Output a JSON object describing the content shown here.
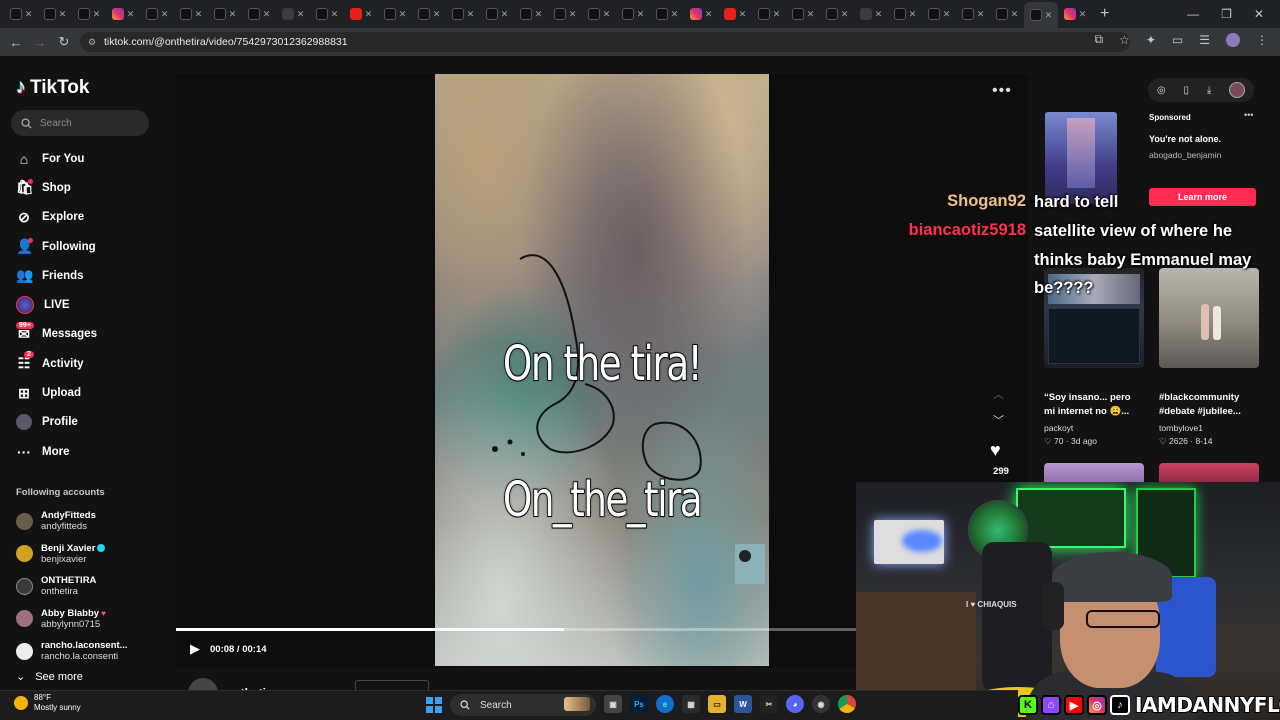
{
  "browser": {
    "url": "tiktok.com/@onthetira/video/7542973012362988831",
    "new_tab": "+",
    "win_controls": [
      "—",
      "❐",
      "✕"
    ]
  },
  "tiktok": {
    "logo_text": "TikTok",
    "search_placeholder": "Search",
    "nav": [
      {
        "label": "For You",
        "icon": "home-icon"
      },
      {
        "label": "Shop",
        "icon": "shop-icon"
      },
      {
        "label": "Explore",
        "icon": "compass-icon"
      },
      {
        "label": "Following",
        "icon": "following-icon"
      },
      {
        "label": "Friends",
        "icon": "friends-icon"
      },
      {
        "label": "LIVE",
        "icon": "live-avatar"
      },
      {
        "label": "Messages",
        "icon": "messages-icon",
        "badge": "99+"
      },
      {
        "label": "Activity",
        "icon": "activity-icon",
        "badge": "2"
      },
      {
        "label": "Upload",
        "icon": "upload-icon"
      },
      {
        "label": "Profile",
        "icon": "profile-avatar"
      },
      {
        "label": "More",
        "icon": "more-icon"
      }
    ],
    "following_header": "Following accounts",
    "accounts": [
      {
        "name": "AndyFitteds",
        "handle": "andyfitteds",
        "color": "#6b5b4b"
      },
      {
        "name": "Benji Xavier",
        "handle": "benjixavier",
        "color": "#d4a020",
        "verified": true
      },
      {
        "name": "ONTHETIRA",
        "handle": "onthetira",
        "color": "#3a3a3a"
      },
      {
        "name": "Abby Blabby",
        "handle": "abbylynn0715",
        "color": "#a07080",
        "heart": true
      },
      {
        "name": "rancho.laconsent...",
        "handle": "rancho.la.consenti",
        "color": "#eeeeee"
      }
    ],
    "see_more": "See more"
  },
  "video": {
    "overlay_line1": "On the tira!",
    "overlay_line2": "On_the_tira",
    "likes": "299",
    "time": "00:08 / 00:14",
    "progress": 0.57,
    "author": "onthetira"
  },
  "ad": {
    "sponsored": "Sponsored",
    "title": "You're not alone.",
    "handle": "abogado_benjamin",
    "cta": "Learn more"
  },
  "recommended": [
    {
      "title": "“Soy insano... pero mi internet no 😩...",
      "author": "packoyt",
      "likes": "70",
      "date": "3d ago"
    },
    {
      "title": "#blackcommunity #debate #jubilee...",
      "author": "tornbylove1",
      "likes": "2626",
      "date": "8-14"
    }
  ],
  "chat": [
    {
      "user": "Shogan92",
      "message": "hard to tell",
      "color": "#f0c080"
    },
    {
      "user": "biancaotiz5918",
      "message": "satellite view of where he thinks baby Emmanuel may be????",
      "color": "#ff3050"
    }
  ],
  "stream": {
    "social_handle": "IAMDANNYFLORES",
    "sign_text": "I ♥ CHIAQUIS"
  },
  "taskbar": {
    "temp": "88°F",
    "condition": "Mostly sunny",
    "search": "Search"
  },
  "colors": {
    "accent": "#fe2c55",
    "tiktok_cyan": "#25f4ee"
  }
}
